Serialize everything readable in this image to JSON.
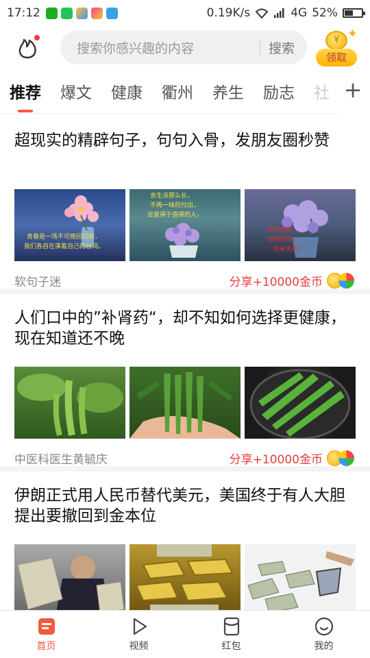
{
  "status_bar": {
    "time": "17:12",
    "network_speed": "0.19K/s",
    "signal": "4G",
    "battery": "52%",
    "battery_level": 0.52
  },
  "header": {
    "search_placeholder": "搜索你感兴趣的内容",
    "search_button": "搜索",
    "reward_label": "领取",
    "reward_coin_symbol": "¥"
  },
  "tabs": [
    {
      "label": "推荐",
      "active": true
    },
    {
      "label": "爆文"
    },
    {
      "label": "健康"
    },
    {
      "label": "衢州"
    },
    {
      "label": "养生"
    },
    {
      "label": "励志"
    },
    {
      "label": "社"
    }
  ],
  "tabs_more": "+",
  "feed": [
    {
      "title": "超现实的精辟句子，句句入骨，发朋友圈秒赞",
      "source": "软句子迷",
      "reward": "分享+10000金币"
    },
    {
      "title": "人们口中的”补肾药“，却不知如何选择更健康，现在知道还不晚",
      "source": "中医科医生黄毓庆",
      "reward": "分享+10000金币"
    },
    {
      "title": "伊朗正式用人民币替代美元，美国终于有人大胆提出要撤回到金本位",
      "source": "",
      "reward": ""
    }
  ],
  "image_text": {
    "img1": [
      "青春是一场不可挽回的别，",
      "我们各自在演着自己的台词。"
    ],
    "img2": [
      "余生没那么长，",
      "不再一味的付出，",
      "去爱得于值得的人。"
    ],
    "img3": [
      "你好你好，",
      "旧时的你，",
      "别来无恙？"
    ]
  },
  "bottom_nav": [
    {
      "label": "首页",
      "active": true
    },
    {
      "label": "视频"
    },
    {
      "label": "红包"
    },
    {
      "label": "我的"
    }
  ],
  "colors": {
    "accent": "#f25a3c",
    "reward_red": "#e63c3c"
  }
}
